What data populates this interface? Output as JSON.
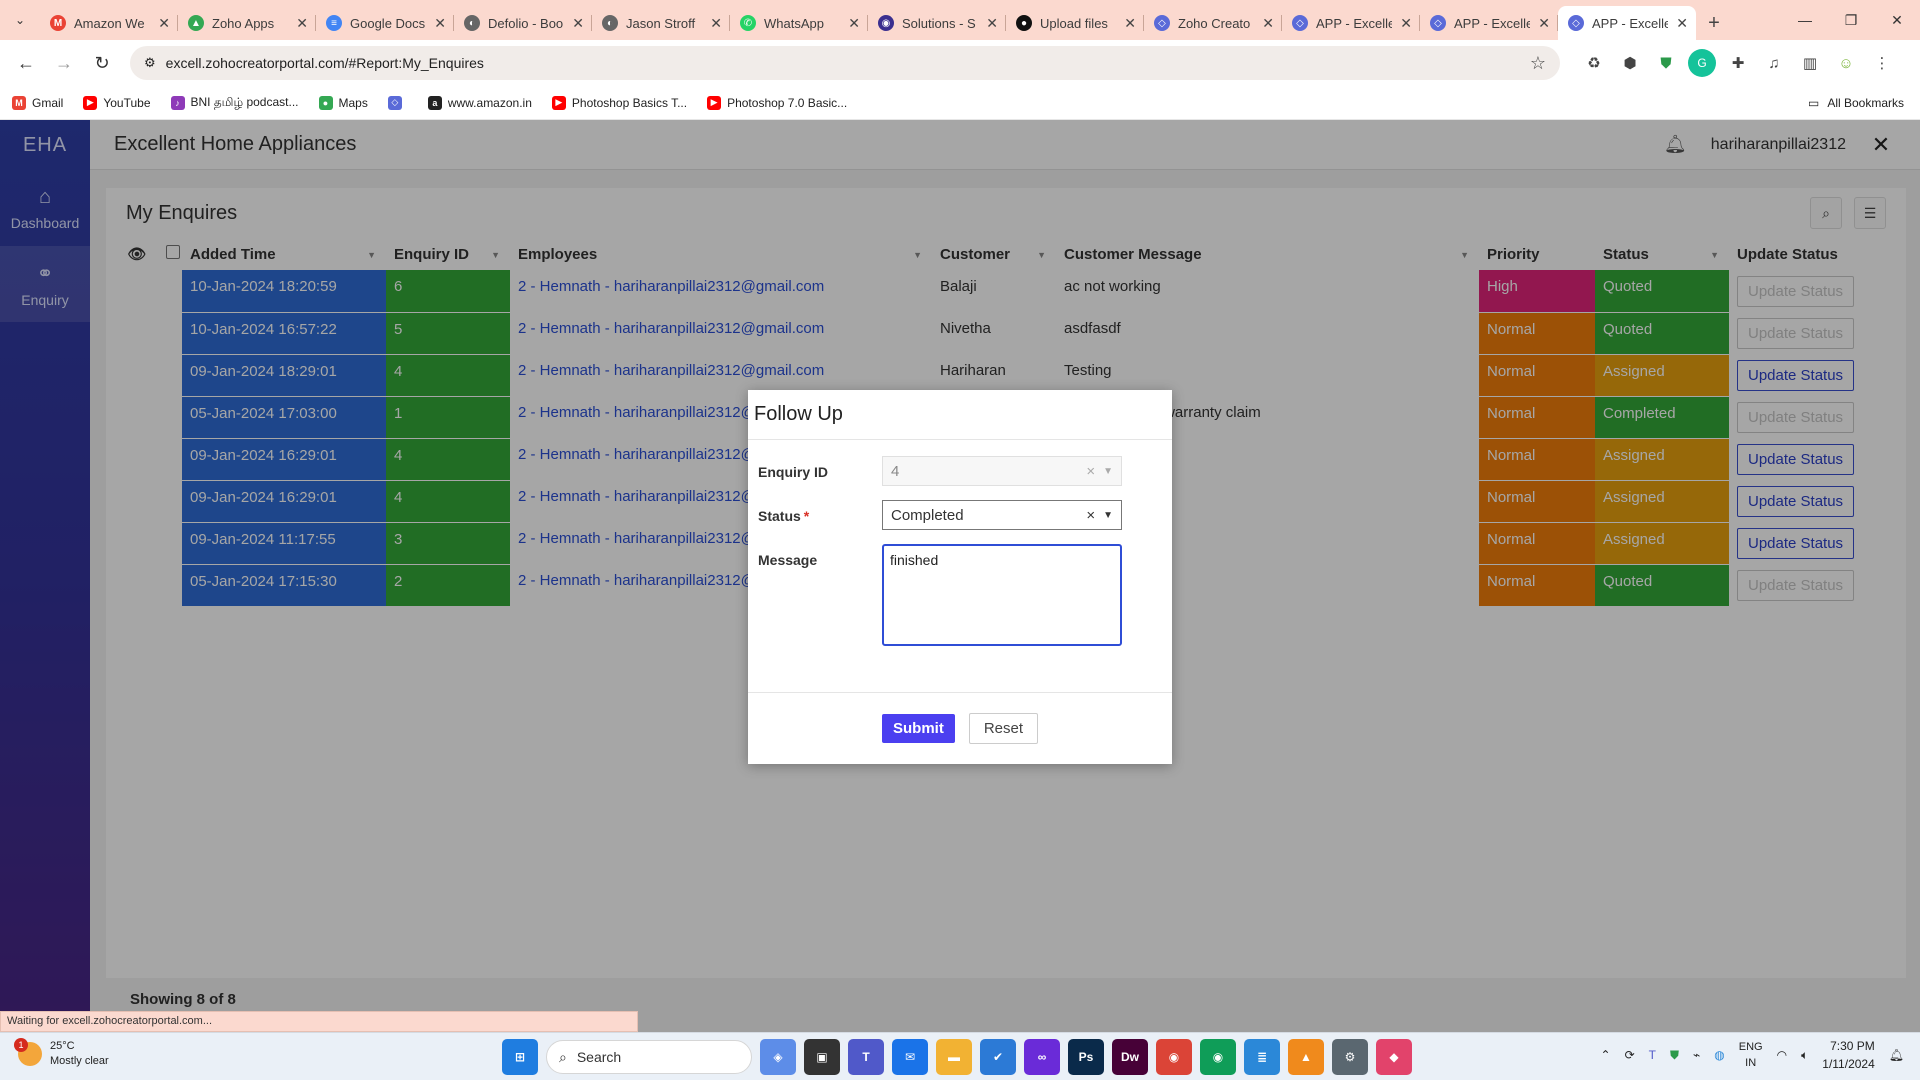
{
  "browser": {
    "tabs": [
      {
        "title": "Amazon We",
        "fav": "M",
        "color": "#ea4335"
      },
      {
        "title": "Zoho Apps",
        "fav": "▲",
        "color": "#34a853"
      },
      {
        "title": "Google Docs",
        "fav": "≡",
        "color": "#4285f4"
      },
      {
        "title": "Defolio - Boo",
        "fav": "◐",
        "color": "#666666"
      },
      {
        "title": "Jason Stroff",
        "fav": "◐",
        "color": "#666666"
      },
      {
        "title": "WhatsApp",
        "fav": "✆",
        "color": "#25d366"
      },
      {
        "title": "Solutions - S",
        "fav": "◉",
        "color": "#3b2f8f"
      },
      {
        "title": "Upload files",
        "fav": "●",
        "color": "#111111"
      },
      {
        "title": "Zoho Creato",
        "fav": "◇",
        "color": "#5a6ad8"
      },
      {
        "title": "APP - Excelle",
        "fav": "◇",
        "color": "#5a6ad8"
      },
      {
        "title": "APP - Excelle",
        "fav": "◇",
        "color": "#5a6ad8"
      },
      {
        "title": "APP - Excelle",
        "fav": "◇",
        "color": "#5a6ad8",
        "active": true
      }
    ],
    "url": "excell.zohocreatorportal.com/#Report:My_Enquires",
    "bookmarks": [
      {
        "label": "Gmail",
        "ic": "M",
        "color": "#ea4335"
      },
      {
        "label": "YouTube",
        "ic": "▶",
        "color": "#ff0000"
      },
      {
        "label": "BNI தமிழ் podcast...",
        "ic": "♪",
        "color": "#8e3ab8"
      },
      {
        "label": "Maps",
        "ic": "●",
        "color": "#34a853"
      },
      {
        "label": "",
        "ic": "◇",
        "color": "#5a6ad8"
      },
      {
        "label": "www.amazon.in",
        "ic": "a",
        "color": "#222222"
      },
      {
        "label": "Photoshop Basics T...",
        "ic": "▶",
        "color": "#ff0000"
      },
      {
        "label": "Photoshop 7.0 Basic...",
        "ic": "▶",
        "color": "#ff0000"
      }
    ],
    "all_bookmarks": "All Bookmarks",
    "status_text": "Waiting for excell.zohocreatorportal.com..."
  },
  "app": {
    "brand": "EHA",
    "title": "Excellent Home Appliances",
    "user": "hariharanpillai2312",
    "sidebar": [
      {
        "label": "Dashboard",
        "icon": "⌂"
      },
      {
        "label": "Enquiry",
        "icon": "⚭"
      }
    ]
  },
  "report": {
    "title": "My Enquires",
    "columns": [
      "Added Time",
      "Enquiry ID",
      "Employees",
      "Customer",
      "Customer Message",
      "Priority",
      "Status",
      "Update Status"
    ],
    "rows": [
      {
        "time": "10-Jan-2024 18:20:59",
        "id": "6",
        "emp": "2 - Hemnath - hariharanpillai2312@gmail.com",
        "cust": "Balaji",
        "msg": "ac not working",
        "pri": "High",
        "status": "Quoted",
        "btn_enabled": false
      },
      {
        "time": "10-Jan-2024 16:57:22",
        "id": "5",
        "emp": "2 - Hemnath - hariharanpillai2312@gmail.com",
        "cust": "Nivetha",
        "msg": "asdfasdf",
        "pri": "Normal",
        "status": "Quoted",
        "btn_enabled": false
      },
      {
        "time": "09-Jan-2024 18:29:01",
        "id": "4",
        "emp": "2 - Hemnath - hariharanpillai2312@gmail.com",
        "cust": "Hariharan",
        "msg": "Testing",
        "pri": "Normal",
        "status": "Assigned",
        "btn_enabled": true
      },
      {
        "time": "05-Jan-2024 17:03:00",
        "id": "1",
        "emp": "2 - Hemnath - hariharanpillai2312@",
        "cust": "",
        "msg": "need to repair, warranty claim",
        "pri": "Normal",
        "status": "Completed",
        "btn_enabled": false
      },
      {
        "time": "09-Jan-2024 16:29:01",
        "id": "4",
        "emp": "2 - Hemnath - hariharanpillai2312@",
        "cust": "",
        "msg": "",
        "pri": "Normal",
        "status": "Assigned",
        "btn_enabled": true
      },
      {
        "time": "09-Jan-2024 16:29:01",
        "id": "4",
        "emp": "2 - Hemnath - hariharanpillai2312@",
        "cust": "",
        "msg": "",
        "pri": "Normal",
        "status": "Assigned",
        "btn_enabled": true
      },
      {
        "time": "09-Jan-2024 11:17:55",
        "id": "3",
        "emp": "2 - Hemnath - hariharanpillai2312@",
        "cust": "",
        "msg": "",
        "pri": "Normal",
        "status": "Assigned",
        "btn_enabled": true
      },
      {
        "time": "05-Jan-2024 17:15:30",
        "id": "2",
        "emp": "2 - Hemnath - hariharanpillai2312@",
        "cust": "",
        "msg": "",
        "pri": "Normal",
        "status": "Quoted",
        "btn_enabled": false
      }
    ],
    "update_label": "Update Status",
    "showing": "Showing 8 of 8",
    "colors": {
      "time": "#2e6cd6",
      "id": "#33a838",
      "High": "#e0247a",
      "Normal": "#f07d0a",
      "Quoted": "#33a838",
      "Assigned": "#e6a00f",
      "Completed": "#33a838"
    }
  },
  "modal": {
    "title": "Follow Up",
    "enquiry_label": "Enquiry ID",
    "enquiry_value": "4",
    "status_label": "Status",
    "status_required": "*",
    "status_value": "Completed",
    "message_label": "Message",
    "message_value": "finished",
    "submit": "Submit",
    "reset": "Reset"
  },
  "taskbar": {
    "temp": "25°C",
    "weather": "Mostly clear",
    "weather_badge": "1",
    "search": "Search",
    "lang1": "ENG",
    "lang2": "IN",
    "time": "7:30 PM",
    "date": "1/11/2024",
    "apps": [
      {
        "name": "windows-start-icon",
        "g": "⊞",
        "c": "#1f7de0"
      },
      {
        "name": "copilot-icon",
        "g": "◈",
        "c": "#5d8de8"
      },
      {
        "name": "task-view-icon",
        "g": "▣",
        "c": "#333333"
      },
      {
        "name": "teams-icon",
        "g": "T",
        "c": "#5059c9"
      },
      {
        "name": "mail-icon",
        "g": "✉",
        "c": "#1a73e8"
      },
      {
        "name": "file-explorer-icon",
        "g": "▬",
        "c": "#f2b233"
      },
      {
        "name": "todo-icon",
        "g": "✔",
        "c": "#2c7ad6"
      },
      {
        "name": "meta-icon",
        "g": "∞",
        "c": "#6a2bd8"
      },
      {
        "name": "photoshop-icon",
        "g": "Ps",
        "c": "#0a2a4a"
      },
      {
        "name": "dreamweaver-icon",
        "g": "Dw",
        "c": "#470137"
      },
      {
        "name": "chrome-icon",
        "g": "◉",
        "c": "#db4437"
      },
      {
        "name": "chrome-alt-icon",
        "g": "◉",
        "c": "#0f9d58"
      },
      {
        "name": "notepad-icon",
        "g": "≣",
        "c": "#2b88d8"
      },
      {
        "name": "app-orange-icon",
        "g": "▲",
        "c": "#f08a1c"
      },
      {
        "name": "settings-icon",
        "g": "⚙",
        "c": "#5a6770"
      },
      {
        "name": "app-pink-icon",
        "g": "◆",
        "c": "#e2436b"
      }
    ]
  }
}
